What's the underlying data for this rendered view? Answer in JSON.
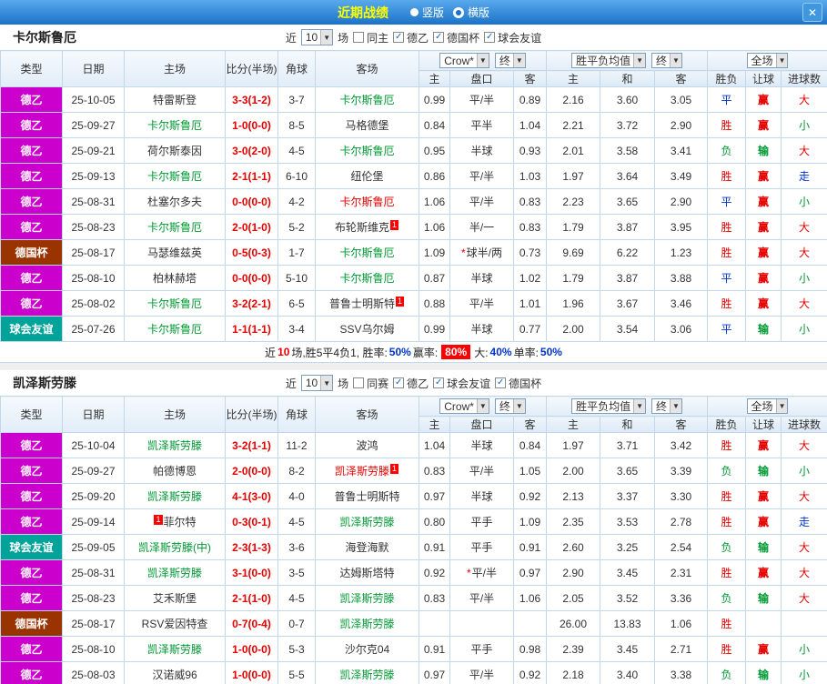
{
  "topbar": {
    "title": "近期战绩",
    "layout_vertical": "竖版",
    "layout_horizontal": "横版",
    "close": "✕"
  },
  "filter_labels": {
    "near": "近",
    "games": "场"
  },
  "header_controls": {
    "company": "Crow*",
    "final": "终",
    "avg": "胜平负均值",
    "scope": "全场"
  },
  "columns": {
    "type": "类型",
    "date": "日期",
    "home": "主场",
    "score": "比分(半场)",
    "corner": "角球",
    "away": "客场",
    "ah_home": "主",
    "ah_line": "盘口",
    "ah_away": "客",
    "eu_home": "主",
    "eu_draw": "和",
    "eu_away": "客",
    "result": "胜负",
    "handicap": "让球",
    "goals": "进球数"
  },
  "colors": {
    "league_d2": "#cc00cc",
    "league_cup": "#993300",
    "league_friendly": "#00a39a",
    "focus_team": "#009933",
    "accent_red": "#e60000",
    "accent_blue": "#0033cc"
  },
  "sections": [
    {
      "team": "卡尔斯鲁厄",
      "filter": {
        "count": "10",
        "same": "同主",
        "leagues": [
          "德乙",
          "德国杯",
          "球会友谊"
        ]
      },
      "rows": [
        {
          "lg": "德乙",
          "lt": "d2",
          "date": "25-10-05",
          "home": {
            "t": "特雷斯登"
          },
          "score": "3-3(1-2)",
          "cor": "3-7",
          "away": {
            "t": "卡尔斯鲁厄",
            "c": "focus"
          },
          "ah": [
            "0.99",
            "平/半",
            "0.89"
          ],
          "star": false,
          "eu": [
            "2.16",
            "3.60",
            "3.05"
          ],
          "res": {
            "t": "平",
            "c": "blue"
          },
          "hr": {
            "t": "赢",
            "c": "red"
          },
          "gr": {
            "t": "大",
            "c": "red"
          }
        },
        {
          "lg": "德乙",
          "lt": "d2",
          "date": "25-09-27",
          "home": {
            "t": "卡尔斯鲁厄",
            "c": "focus"
          },
          "score": "1-0(0-0)",
          "cor": "8-5",
          "away": {
            "t": "马格德堡"
          },
          "ah": [
            "0.84",
            "平半",
            "1.04"
          ],
          "star": false,
          "eu": [
            "2.21",
            "3.72",
            "2.90"
          ],
          "res": {
            "t": "胜",
            "c": "red"
          },
          "hr": {
            "t": "赢",
            "c": "red"
          },
          "gr": {
            "t": "小",
            "c": "green"
          }
        },
        {
          "lg": "德乙",
          "lt": "d2",
          "date": "25-09-21",
          "home": {
            "t": "荷尔斯泰因"
          },
          "score": "3-0(2-0)",
          "cor": "4-5",
          "away": {
            "t": "卡尔斯鲁厄",
            "c": "focus"
          },
          "ah": [
            "0.95",
            "半球",
            "0.93"
          ],
          "star": false,
          "eu": [
            "2.01",
            "3.58",
            "3.41"
          ],
          "res": {
            "t": "负",
            "c": "green"
          },
          "hr": {
            "t": "输",
            "c": "green"
          },
          "gr": {
            "t": "大",
            "c": "red"
          }
        },
        {
          "lg": "德乙",
          "lt": "d2",
          "date": "25-09-13",
          "home": {
            "t": "卡尔斯鲁厄",
            "c": "focus"
          },
          "score": "2-1(1-1)",
          "cor": "6-10",
          "away": {
            "t": "纽伦堡"
          },
          "ah": [
            "0.86",
            "平/半",
            "1.03"
          ],
          "star": false,
          "eu": [
            "1.97",
            "3.64",
            "3.49"
          ],
          "res": {
            "t": "胜",
            "c": "red"
          },
          "hr": {
            "t": "赢",
            "c": "red"
          },
          "gr": {
            "t": "走",
            "c": "blue"
          }
        },
        {
          "lg": "德乙",
          "lt": "d2",
          "date": "25-08-31",
          "home": {
            "t": "杜塞尔多夫"
          },
          "score": "0-0(0-0)",
          "cor": "4-2",
          "away": {
            "t": "卡尔斯鲁厄",
            "c": "focusred"
          },
          "ah": [
            "1.06",
            "平/半",
            "0.83"
          ],
          "star": false,
          "eu": [
            "2.23",
            "3.65",
            "2.90"
          ],
          "res": {
            "t": "平",
            "c": "blue"
          },
          "hr": {
            "t": "赢",
            "c": "red"
          },
          "gr": {
            "t": "小",
            "c": "green"
          }
        },
        {
          "lg": "德乙",
          "lt": "d2",
          "date": "25-08-23",
          "home": {
            "t": "卡尔斯鲁厄",
            "c": "focus"
          },
          "score": "2-0(1-0)",
          "cor": "5-2",
          "away": {
            "t": "布轮斯维克",
            "b": "1"
          },
          "ah": [
            "1.06",
            "半/一",
            "0.83"
          ],
          "star": false,
          "eu": [
            "1.79",
            "3.87",
            "3.95"
          ],
          "res": {
            "t": "胜",
            "c": "red"
          },
          "hr": {
            "t": "赢",
            "c": "red"
          },
          "gr": {
            "t": "大",
            "c": "red"
          }
        },
        {
          "lg": "德国杯",
          "lt": "cup",
          "date": "25-08-17",
          "home": {
            "t": "马瑟维兹英"
          },
          "score": "0-5(0-3)",
          "cor": "1-7",
          "away": {
            "t": "卡尔斯鲁厄",
            "c": "focus"
          },
          "ah": [
            "1.09",
            "球半/两",
            "0.73"
          ],
          "star": true,
          "eu": [
            "9.69",
            "6.22",
            "1.23"
          ],
          "res": {
            "t": "胜",
            "c": "red"
          },
          "hr": {
            "t": "赢",
            "c": "red"
          },
          "gr": {
            "t": "大",
            "c": "red"
          }
        },
        {
          "lg": "德乙",
          "lt": "d2",
          "date": "25-08-10",
          "home": {
            "t": "柏林赫塔"
          },
          "score": "0-0(0-0)",
          "cor": "5-10",
          "away": {
            "t": "卡尔斯鲁厄",
            "c": "focus"
          },
          "ah": [
            "0.87",
            "半球",
            "1.02"
          ],
          "star": false,
          "eu": [
            "1.79",
            "3.87",
            "3.88"
          ],
          "res": {
            "t": "平",
            "c": "blue"
          },
          "hr": {
            "t": "赢",
            "c": "red"
          },
          "gr": {
            "t": "小",
            "c": "green"
          }
        },
        {
          "lg": "德乙",
          "lt": "d2",
          "date": "25-08-02",
          "home": {
            "t": "卡尔斯鲁厄",
            "c": "focus"
          },
          "score": "3-2(2-1)",
          "cor": "6-5",
          "away": {
            "t": "普鲁士明斯特",
            "b": "1"
          },
          "ah": [
            "0.88",
            "平/半",
            "1.01"
          ],
          "star": false,
          "eu": [
            "1.96",
            "3.67",
            "3.46"
          ],
          "res": {
            "t": "胜",
            "c": "red"
          },
          "hr": {
            "t": "赢",
            "c": "red"
          },
          "gr": {
            "t": "大",
            "c": "red"
          }
        },
        {
          "lg": "球会友谊",
          "lt": "fr",
          "date": "25-07-26",
          "home": {
            "t": "卡尔斯鲁厄",
            "c": "focus"
          },
          "score": "1-1(1-1)",
          "cor": "3-4",
          "away": {
            "t": "SSV乌尔姆"
          },
          "ah": [
            "0.99",
            "半球",
            "0.77"
          ],
          "star": false,
          "eu": [
            "2.00",
            "3.54",
            "3.06"
          ],
          "res": {
            "t": "平",
            "c": "blue"
          },
          "hr": {
            "t": "输",
            "c": "green"
          },
          "gr": {
            "t": "小",
            "c": "green"
          }
        }
      ],
      "summary": {
        "parts": [
          {
            "t": "近",
            "c": "k"
          },
          {
            "t": "10",
            "c": "r"
          },
          {
            "t": "场,胜5平4负1, 胜率:",
            "c": "k"
          },
          {
            "t": "50%",
            "c": "b"
          },
          {
            "t": " 赢率: ",
            "c": "k"
          },
          {
            "t": "80%",
            "c": "badge"
          },
          {
            "t": " 大:",
            "c": "k"
          },
          {
            "t": "40%",
            "c": "b"
          },
          {
            "t": " 单率:",
            "c": "k"
          },
          {
            "t": "50%",
            "c": "b"
          }
        ]
      }
    },
    {
      "team": "凯泽斯劳滕",
      "filter": {
        "count": "10",
        "same": "同赛",
        "leagues": [
          "德乙",
          "球会友谊",
          "德国杯"
        ]
      },
      "rows": [
        {
          "lg": "德乙",
          "lt": "d2",
          "date": "25-10-04",
          "home": {
            "t": "凯泽斯劳滕",
            "c": "focus"
          },
          "score": "3-2(1-1)",
          "cor": "11-2",
          "away": {
            "t": "波鸿"
          },
          "ah": [
            "1.04",
            "半球",
            "0.84"
          ],
          "star": false,
          "eu": [
            "1.97",
            "3.71",
            "3.42"
          ],
          "res": {
            "t": "胜",
            "c": "red"
          },
          "hr": {
            "t": "赢",
            "c": "red"
          },
          "gr": {
            "t": "大",
            "c": "red"
          }
        },
        {
          "lg": "德乙",
          "lt": "d2",
          "date": "25-09-27",
          "home": {
            "t": "帕德博恩"
          },
          "score": "2-0(0-0)",
          "cor": "8-2",
          "away": {
            "t": "凯泽斯劳滕",
            "c": "focusred",
            "b": "1"
          },
          "ah": [
            "0.83",
            "平/半",
            "1.05"
          ],
          "star": false,
          "eu": [
            "2.00",
            "3.65",
            "3.39"
          ],
          "res": {
            "t": "负",
            "c": "green"
          },
          "hr": {
            "t": "输",
            "c": "green"
          },
          "gr": {
            "t": "小",
            "c": "green"
          }
        },
        {
          "lg": "德乙",
          "lt": "d2",
          "date": "25-09-20",
          "home": {
            "t": "凯泽斯劳滕",
            "c": "focus"
          },
          "score": "4-1(3-0)",
          "cor": "4-0",
          "away": {
            "t": "普鲁士明斯特"
          },
          "ah": [
            "0.97",
            "半球",
            "0.92"
          ],
          "star": false,
          "eu": [
            "2.13",
            "3.37",
            "3.30"
          ],
          "res": {
            "t": "胜",
            "c": "red"
          },
          "hr": {
            "t": "赢",
            "c": "red"
          },
          "gr": {
            "t": "大",
            "c": "red"
          }
        },
        {
          "lg": "德乙",
          "lt": "d2",
          "date": "25-09-14",
          "home": {
            "t": "菲尔特",
            "b": "1",
            "bp": "before"
          },
          "score": "0-3(0-1)",
          "cor": "4-5",
          "away": {
            "t": "凯泽斯劳滕",
            "c": "focus"
          },
          "ah": [
            "0.80",
            "平手",
            "1.09"
          ],
          "star": false,
          "eu": [
            "2.35",
            "3.53",
            "2.78"
          ],
          "res": {
            "t": "胜",
            "c": "red"
          },
          "hr": {
            "t": "赢",
            "c": "red"
          },
          "gr": {
            "t": "走",
            "c": "blue"
          }
        },
        {
          "lg": "球会友谊",
          "lt": "fr",
          "date": "25-09-05",
          "home": {
            "t": "凯泽斯劳滕(中)",
            "c": "focus"
          },
          "score": "2-3(1-3)",
          "cor": "3-6",
          "away": {
            "t": "海登海默"
          },
          "ah": [
            "0.91",
            "平手",
            "0.91"
          ],
          "star": false,
          "eu": [
            "2.60",
            "3.25",
            "2.54"
          ],
          "res": {
            "t": "负",
            "c": "green"
          },
          "hr": {
            "t": "输",
            "c": "green"
          },
          "gr": {
            "t": "大",
            "c": "red"
          }
        },
        {
          "lg": "德乙",
          "lt": "d2",
          "date": "25-08-31",
          "home": {
            "t": "凯泽斯劳滕",
            "c": "focus"
          },
          "score": "3-1(0-0)",
          "cor": "3-5",
          "away": {
            "t": "达姆斯塔特"
          },
          "ah": [
            "0.92",
            "平/半",
            "0.97"
          ],
          "star": true,
          "eu": [
            "2.90",
            "3.45",
            "2.31"
          ],
          "res": {
            "t": "胜",
            "c": "red"
          },
          "hr": {
            "t": "赢",
            "c": "red"
          },
          "gr": {
            "t": "大",
            "c": "red"
          }
        },
        {
          "lg": "德乙",
          "lt": "d2",
          "date": "25-08-23",
          "home": {
            "t": "艾禾斯堡"
          },
          "score": "2-1(1-0)",
          "cor": "4-5",
          "away": {
            "t": "凯泽斯劳滕",
            "c": "focus"
          },
          "ah": [
            "0.83",
            "平/半",
            "1.06"
          ],
          "star": false,
          "eu": [
            "2.05",
            "3.52",
            "3.36"
          ],
          "res": {
            "t": "负",
            "c": "green"
          },
          "hr": {
            "t": "输",
            "c": "green"
          },
          "gr": {
            "t": "大",
            "c": "red"
          }
        },
        {
          "lg": "德国杯",
          "lt": "cup",
          "date": "25-08-17",
          "home": {
            "t": "RSV爱因特查"
          },
          "score": "0-7(0-4)",
          "cor": "0-7",
          "away": {
            "t": "凯泽斯劳滕",
            "c": "focus"
          },
          "ah": [
            "",
            "",
            ""
          ],
          "star": false,
          "eu": [
            "26.00",
            "13.83",
            "1.06"
          ],
          "res": {
            "t": "胜",
            "c": "red"
          },
          "hr": {
            "t": "",
            "c": "red"
          },
          "gr": {
            "t": "",
            "c": "red"
          }
        },
        {
          "lg": "德乙",
          "lt": "d2",
          "date": "25-08-10",
          "home": {
            "t": "凯泽斯劳滕",
            "c": "focus"
          },
          "score": "1-0(0-0)",
          "cor": "5-3",
          "away": {
            "t": "沙尔克04"
          },
          "ah": [
            "0.91",
            "平手",
            "0.98"
          ],
          "star": false,
          "eu": [
            "2.39",
            "3.45",
            "2.71"
          ],
          "res": {
            "t": "胜",
            "c": "red"
          },
          "hr": {
            "t": "赢",
            "c": "red"
          },
          "gr": {
            "t": "小",
            "c": "green"
          }
        },
        {
          "lg": "德乙",
          "lt": "d2",
          "date": "25-08-03",
          "home": {
            "t": "汉诺威96"
          },
          "score": "1-0(0-0)",
          "cor": "5-5",
          "away": {
            "t": "凯泽斯劳滕",
            "c": "focus"
          },
          "ah": [
            "0.97",
            "平/半",
            "0.92"
          ],
          "star": false,
          "eu": [
            "2.18",
            "3.40",
            "3.38"
          ],
          "res": {
            "t": "负",
            "c": "green"
          },
          "hr": {
            "t": "输",
            "c": "green"
          },
          "gr": {
            "t": "小",
            "c": "green"
          }
        }
      ]
    }
  ]
}
